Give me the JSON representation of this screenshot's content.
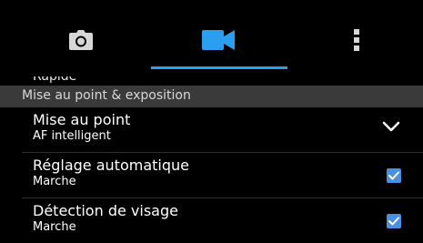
{
  "tabs": {
    "camera_icon": "camera-icon",
    "video_icon": "video-camera-icon",
    "more_icon": "vertical-ellipsis-icon",
    "active_color": "#2a9ff2"
  },
  "clipped_item_label": "Rapide",
  "section": {
    "title": "Mise au point & exposition"
  },
  "settings": [
    {
      "title": "Mise au point",
      "value": "AF intelligent",
      "control": "dropdown"
    },
    {
      "title": "Réglage automatique",
      "value": "Marche",
      "control": "checkbox",
      "checked": true
    },
    {
      "title": "Détection de visage",
      "value": "Marche",
      "control": "checkbox",
      "checked": true
    }
  ],
  "colors": {
    "checkbox": "#4a90e2",
    "section_bg": "#3a3a3a"
  }
}
